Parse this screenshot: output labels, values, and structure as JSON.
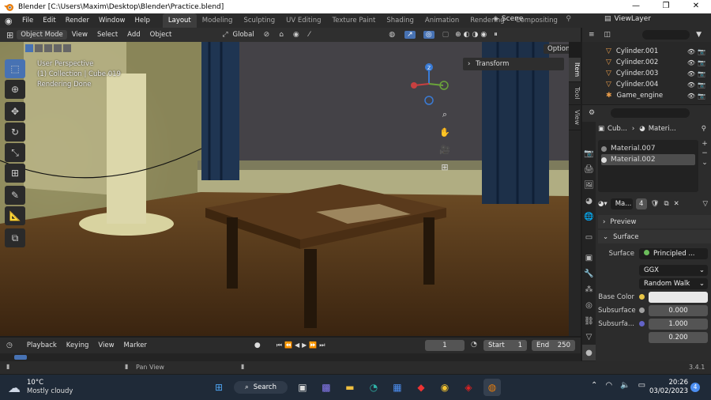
{
  "window": {
    "title": "Blender [C:\\Users\\Maxim\\Desktop\\Blender\\Practice.blend]",
    "min": "—",
    "max": "❐",
    "close": "✕"
  },
  "menu": {
    "items": [
      "File",
      "Edit",
      "Render",
      "Window",
      "Help"
    ],
    "workspaces": [
      "Layout",
      "Modeling",
      "Sculpting",
      "UV Editing",
      "Texture Paint",
      "Shading",
      "Animation",
      "Rendering",
      "Compositing"
    ],
    "active_workspace": "Layout",
    "scene": "Scene",
    "view_layer": "ViewLayer"
  },
  "viewport_header": {
    "mode": "Object Mode",
    "menus": [
      "View",
      "Select",
      "Add",
      "Object"
    ],
    "orientation": "Global",
    "options": "Options"
  },
  "viewport": {
    "info_line1": "User Perspective",
    "info_line2": "(1) Collection | Cube.019",
    "info_line3": "Rendering Done",
    "transform": "Transform",
    "gizmo_z": "Z",
    "side_tabs": [
      "Item",
      "Tool",
      "View"
    ]
  },
  "outliner": {
    "rows": [
      "Cylinder.001",
      "Cylinder.002",
      "Cylinder.003",
      "Cylinder.004",
      "Game_engine"
    ]
  },
  "properties": {
    "breadcrumb_object": "Cub...",
    "breadcrumb_material": "Materi...",
    "slots": [
      "Material.007",
      "Material.002"
    ],
    "material_name": "Ma...",
    "user_count": "4",
    "preview": "Preview",
    "surface_section": "Surface",
    "surface_label": "Surface",
    "surface_value": "Principled ...",
    "distribution": "GGX",
    "subsurface_method": "Random Walk",
    "base_color_label": "Base Color",
    "base_color": "#e8e8e8",
    "subsurface_label": "Subsurface",
    "subsurface_value": "0.000",
    "subsurface_radius_label": "Subsurfa...",
    "radius_1": "1.000",
    "radius_2": "0.200"
  },
  "timeline": {
    "menus": [
      "Playback",
      "Keying",
      "View",
      "Marker"
    ],
    "current_frame": "1",
    "start_label": "Start",
    "start": "1",
    "end_label": "End",
    "end": "250"
  },
  "status": {
    "pan_view": "Pan View",
    "version": "3.4.1"
  },
  "taskbar": {
    "temp": "10°C",
    "weather": "Mostly cloudy",
    "search": "Search",
    "time": "20:26",
    "date": "03/02/2023",
    "notifications": "4"
  }
}
